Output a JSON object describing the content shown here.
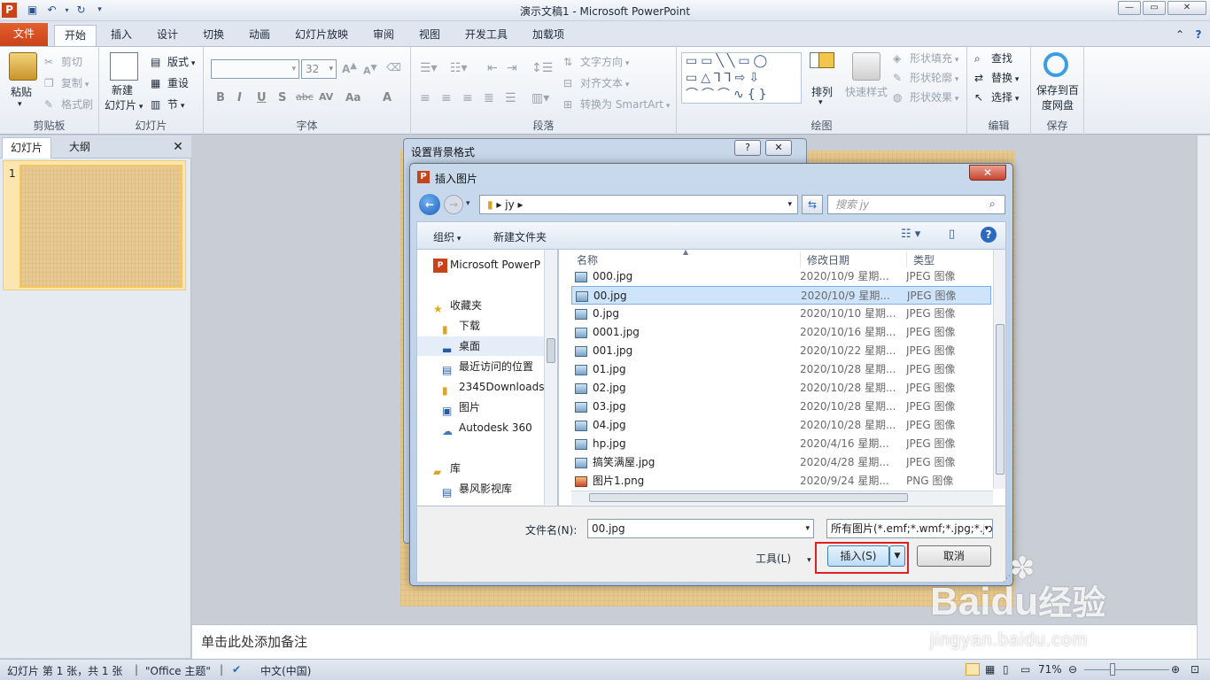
{
  "app": {
    "title": "演示文稿1 - Microsoft PowerPoint"
  },
  "tabs": [
    "文件",
    "开始",
    "插入",
    "设计",
    "切换",
    "动画",
    "幻灯片放映",
    "审阅",
    "视图",
    "开发工具",
    "加载项"
  ],
  "ribbon": {
    "clipboard": {
      "group": "剪贴板",
      "paste": "粘贴",
      "cut": "剪切",
      "copy": "复制",
      "painter": "格式刷"
    },
    "slides": {
      "group": "幻灯片",
      "new_slide_1": "新建",
      "new_slide_2": "幻灯片",
      "layout": "版式",
      "reset": "重设",
      "section": "节"
    },
    "font": {
      "group": "字体",
      "font_size": "32",
      "bold": "B",
      "italic": "I",
      "underline": "U",
      "shadow": "S",
      "strike": "abc",
      "spacing": "AV",
      "case": "Aa",
      "color": "A"
    },
    "paragraph": {
      "group": "段落",
      "text_direction": "文字方向",
      "align_text": "对齐文本",
      "smartart": "转换为 SmartArt"
    },
    "drawing": {
      "group": "绘图",
      "arrange": "排列",
      "quick_styles": "快速样式",
      "fill": "形状填充",
      "outline": "形状轮廓",
      "effects": "形状效果"
    },
    "editing": {
      "group": "编辑",
      "find": "查找",
      "replace": "替换",
      "select": "选择"
    },
    "save": {
      "group": "保存",
      "label1": "保存到百",
      "label2": "度网盘"
    }
  },
  "left_pane": {
    "tab_slides": "幻灯片",
    "tab_outline": "大纲",
    "slide_number": "1"
  },
  "notes": {
    "placeholder": "单击此处添加备注"
  },
  "bg_dialog": {
    "title": "设置背景格式",
    "help": "?",
    "close": "✕"
  },
  "insert_dialog": {
    "title": "插入图片",
    "path": "jy",
    "search_placeholder": "搜索 jy",
    "organize": "组织",
    "new_folder": "新建文件夹",
    "nav": [
      {
        "label": "Microsoft PowerP",
        "icon": "powerpoint-icon"
      },
      {
        "label": "收藏夹",
        "icon": "star-icon"
      },
      {
        "label": "下载",
        "icon": "download-icon"
      },
      {
        "label": "桌面",
        "icon": "desktop-icon"
      },
      {
        "label": "最近访问的位置",
        "icon": "recent-icon"
      },
      {
        "label": "2345Downloads",
        "icon": "folder-icon"
      },
      {
        "label": "图片",
        "icon": "pictures-icon"
      },
      {
        "label": "Autodesk 360",
        "icon": "cloud-icon"
      },
      {
        "label": "库",
        "icon": "library-icon"
      },
      {
        "label": "暴风影视库",
        "icon": "video-library-icon"
      }
    ],
    "columns": {
      "name": "名称",
      "date": "修改日期",
      "type": "类型"
    },
    "files": [
      {
        "name": "000.jpg",
        "date": "2020/10/9 星期...",
        "type": "JPEG 图像"
      },
      {
        "name": "00.jpg",
        "date": "2020/10/9 星期...",
        "type": "JPEG 图像"
      },
      {
        "name": "0.jpg",
        "date": "2020/10/10 星期...",
        "type": "JPEG 图像"
      },
      {
        "name": "0001.jpg",
        "date": "2020/10/16 星期...",
        "type": "JPEG 图像"
      },
      {
        "name": "001.jpg",
        "date": "2020/10/22 星期...",
        "type": "JPEG 图像"
      },
      {
        "name": "01.jpg",
        "date": "2020/10/28 星期...",
        "type": "JPEG 图像"
      },
      {
        "name": "02.jpg",
        "date": "2020/10/28 星期...",
        "type": "JPEG 图像"
      },
      {
        "name": "03.jpg",
        "date": "2020/10/28 星期...",
        "type": "JPEG 图像"
      },
      {
        "name": "04.jpg",
        "date": "2020/10/28 星期...",
        "type": "JPEG 图像"
      },
      {
        "name": "hp.jpg",
        "date": "2020/4/16 星期...",
        "type": "JPEG 图像"
      },
      {
        "name": "搞笑满屋.jpg",
        "date": "2020/4/28 星期...",
        "type": "JPEG 图像"
      },
      {
        "name": "图片1.png",
        "date": "2020/9/24 星期...",
        "type": "PNG 图像"
      }
    ],
    "selected_file": "00.jpg",
    "filename_label": "文件名(N):",
    "filename_value": "00.jpg",
    "filetype_value": "所有图片(*.emf;*.wmf;*.jpg;*.jp",
    "tools": "工具(L)",
    "insert": "插入(S)",
    "cancel": "取消"
  },
  "status": {
    "slide_info": "幻灯片 第 1 张，共 1 张",
    "theme": "\"Office 主题\"",
    "language": "中文(中国)",
    "zoom": "71%"
  },
  "watermark": {
    "text1": "Bai",
    "text2": "du",
    "text3": "经验",
    "url": "jingyan.baidu.com"
  },
  "colors": {
    "file_tab": "#d04a1e",
    "selection": "#cde4fb",
    "highlight_box": "#e02020"
  }
}
